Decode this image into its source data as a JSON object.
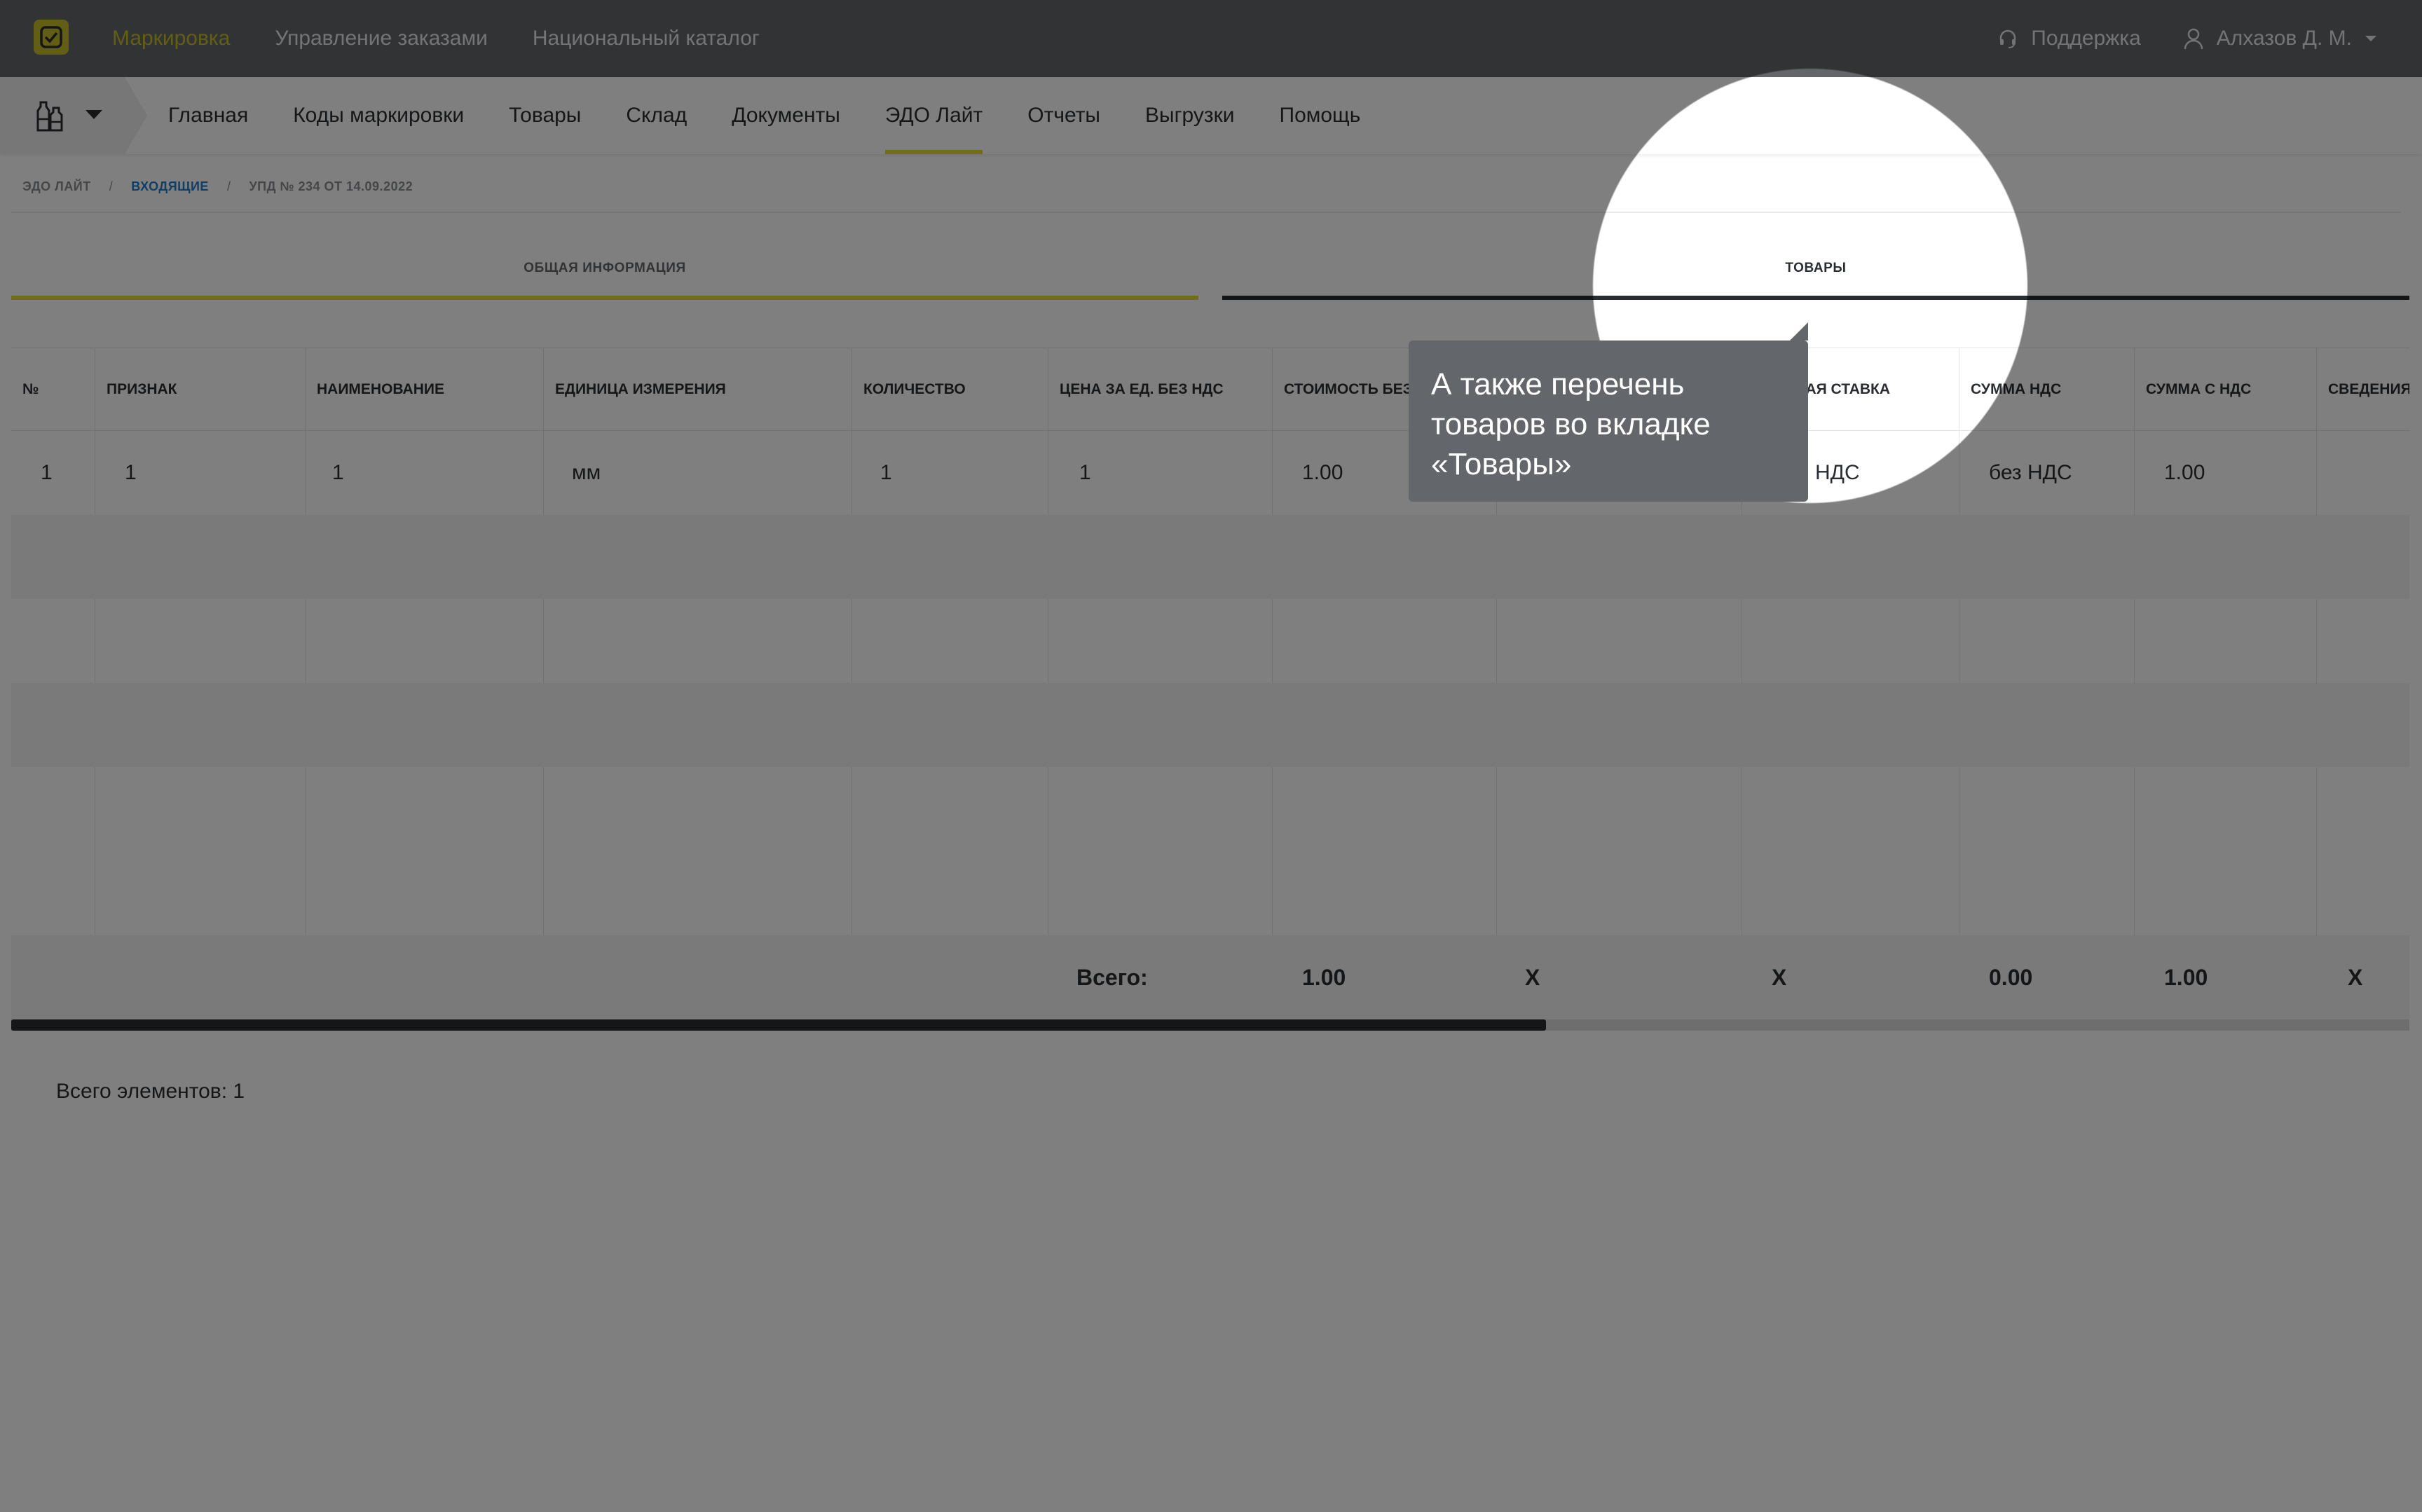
{
  "topbar": {
    "nav": [
      "Маркировка",
      "Управление заказами",
      "Национальный каталог"
    ],
    "support": "Поддержка",
    "user": "Алхазов Д. М."
  },
  "subnav": {
    "links": [
      "Главная",
      "Коды маркировки",
      "Товары",
      "Склад",
      "Документы",
      "ЭДО Лайт",
      "Отчеты",
      "Выгрузки",
      "Помощь"
    ],
    "active": "ЭДО Лайт"
  },
  "breadcrumb": {
    "root": "ЭДО ЛАЙТ",
    "section": "ВХОДЯЩИЕ",
    "current": "УПД № 234 ОТ 14.09.2022"
  },
  "tabs": {
    "general": "ОБЩАЯ ИНФОРМАЦИЯ",
    "goods": "ТОВАРЫ"
  },
  "table": {
    "headers": [
      "№",
      "ПРИЗНАК",
      "НАИМЕНОВАНИЕ",
      "ЕДИНИЦА ИЗМЕРЕНИЯ",
      "КОЛИЧЕСТВО",
      "ЦЕНА ЗА ЕД. БЕЗ НДС",
      "СТОИМОСТЬ БЕЗ",
      "",
      "ОВАЯ СТАВКА",
      "СУММА НДС",
      "СУММА С НДС",
      "СВЕДЕНИЯ"
    ],
    "row": [
      "1",
      "1",
      "1",
      "мм",
      "1",
      "1",
      "1.00",
      "",
      "НДС",
      "без НДС",
      "1.00"
    ],
    "totals": {
      "label": "Всего:",
      "cost": "1.00",
      "x1": "X",
      "x2": "X",
      "vat_sum": "0.00",
      "sum_with_vat": "1.00",
      "x3": "X"
    },
    "scroll_position": 0.64
  },
  "summary": "Всего элементов: 1",
  "tooltip": "А также перечень товаров во вкладке «Товары»",
  "colors": {
    "topbar": "#63666a",
    "accent": "#c4bd2c",
    "active_underline": "#e5dc2f",
    "link": "#1e7ccc",
    "text": "#2a2d31"
  }
}
